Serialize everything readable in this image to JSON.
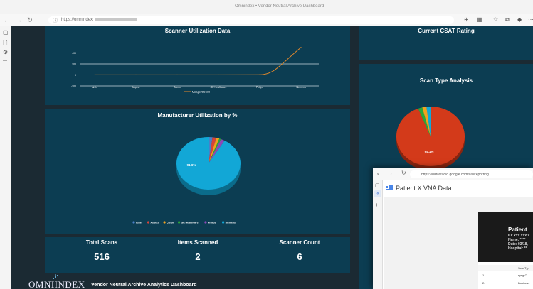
{
  "browser": {
    "title": "Omnindex • Vendor Neutral Archive Dashboard",
    "url": "https://omnindex"
  },
  "dashboard": {
    "line_panel": {
      "title": "Scanner Utilization Data",
      "legend": "Usage Count"
    },
    "csat_panel": {
      "title": "Current CSAT Rating"
    },
    "scan_type_panel": {
      "title": "Scan Type Analysis",
      "pie_label": "94.1%"
    },
    "pie_panel": {
      "title": "Manufacturer Utilization by %",
      "pie_label": "91.6%"
    },
    "stats": [
      {
        "label": "Total Scans",
        "value": "516"
      },
      {
        "label": "Items Scanned",
        "value": "2"
      },
      {
        "label": "Scanner Count",
        "value": "6"
      }
    ],
    "footer": {
      "logo": "OMNIINDEX",
      "subtitle": "Vendor Neutral Archive Analytics Dashboard"
    }
  },
  "chart_data": [
    {
      "type": "line",
      "title": "Scanner Utilization Data",
      "categories": [
        "Aisin",
        "Aspect",
        "Canon",
        "GE Healthcare",
        "Philips",
        "Siemens"
      ],
      "series": [
        {
          "name": "Usage Count",
          "values": [
            1,
            1,
            1,
            1,
            3,
            500
          ],
          "color": "#e0882c"
        }
      ],
      "ylim": [
        -200,
        600
      ],
      "yticks": [
        "400",
        "200",
        "0",
        "-200"
      ],
      "grid": true,
      "legend": "bottom"
    },
    {
      "type": "pie",
      "title": "Manufacturer Utilization by %",
      "labels": [
        "Aisin",
        "Aspect",
        "Canon",
        "GE Healthcare",
        "Philips",
        "Siemens"
      ],
      "values": [
        2.0,
        2.0,
        1.5,
        0.9,
        2.0,
        91.6
      ],
      "colors": [
        "#4a7fc8",
        "#d5443a",
        "#f2a21e",
        "#2aa63b",
        "#8b4ab7",
        "#12a7d6"
      ],
      "data_label": "91.6%",
      "legend": "bottom"
    },
    {
      "type": "pie",
      "title": "Scan Type Analysis",
      "labels": [
        "",
        "",
        "",
        ""
      ],
      "values": [
        94.1,
        2.0,
        2.0,
        1.9
      ],
      "colors": [
        "#d33a1a",
        "#2aa63b",
        "#f2a21e",
        "#12a7d6"
      ],
      "data_label": "94.1%"
    }
  ],
  "overlay": {
    "url": "https://datastudio.google.com/u/0/reporting",
    "tab_title": "Patient X VNA Data",
    "doc": {
      "heading": "Patient",
      "lines": [
        "ID: xxx xxx x",
        "Name: ****",
        "Date: 03/18,",
        "Hospital: **"
      ],
      "table_header": "ScanTyp",
      "rows": [
        {
          "num": "1.",
          "text": "sysg-C"
        },
        {
          "num": "2.",
          "text": "Business"
        }
      ]
    }
  }
}
